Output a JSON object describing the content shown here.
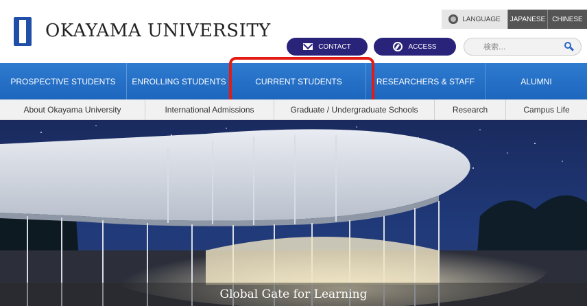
{
  "header": {
    "logo_text": "OKAYAMA UNIVERSITY",
    "language": {
      "label": "LANGUAGE",
      "options": [
        "JAPANESE",
        "CHINESE"
      ]
    },
    "contact_label": "CONTACT",
    "access_label": "ACCESS",
    "search_placeholder": "検索..."
  },
  "main_nav": {
    "items": [
      {
        "label": "PROSPECTIVE STUDENTS"
      },
      {
        "label": "ENROLLING STUDENTS"
      },
      {
        "label": "CURRENT STUDENTS"
      },
      {
        "label": "RESEARCHERS & STAFF"
      },
      {
        "label": "ALUMNI"
      }
    ]
  },
  "sub_nav": {
    "items": [
      {
        "label": "About Okayama University"
      },
      {
        "label": "International Admissions"
      },
      {
        "label": "Graduate / Undergraduate Schools"
      },
      {
        "label": "Research"
      },
      {
        "label": "Campus Life"
      }
    ]
  },
  "hero": {
    "caption": "Global Gate for Learning"
  },
  "colors": {
    "brand_blue": "#1f4fa6",
    "nav_blue": "#2670c8",
    "pill_navy": "#2a237a",
    "highlight_red": "#e31b12"
  }
}
